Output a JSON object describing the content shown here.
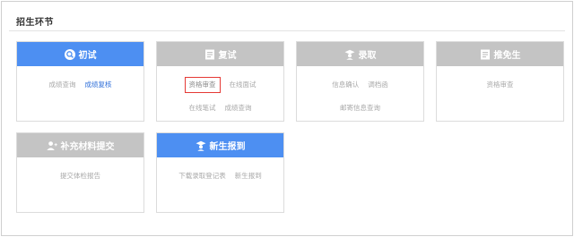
{
  "section": {
    "title": "招生环节"
  },
  "cards": [
    {
      "title": "初试",
      "icon": "search-icon",
      "links": [
        "成绩查询",
        "成绩复核"
      ]
    },
    {
      "title": "复试",
      "icon": "document-icon",
      "links": [
        "资格审查",
        "在线面试",
        "在线笔试",
        "成绩查询"
      ]
    },
    {
      "title": "录取",
      "icon": "graduate-icon",
      "links": [
        "信息确认",
        "调档函",
        "邮寄信息查询"
      ]
    },
    {
      "title": "推免生",
      "icon": "document-icon",
      "links": [
        "资格审查"
      ]
    },
    {
      "title": "补充材料提交",
      "icon": "user-plus-icon",
      "links": [
        "提交体检报告"
      ]
    },
    {
      "title": "新生报到",
      "icon": "graduate-icon",
      "links": [
        "下载录取登记表",
        "新生报到"
      ]
    }
  ],
  "colors": {
    "active_header": "#4d8ff2",
    "inactive_header": "#c4c4c4",
    "highlight_box": "#e53935",
    "active_link": "#2f6fd9"
  }
}
